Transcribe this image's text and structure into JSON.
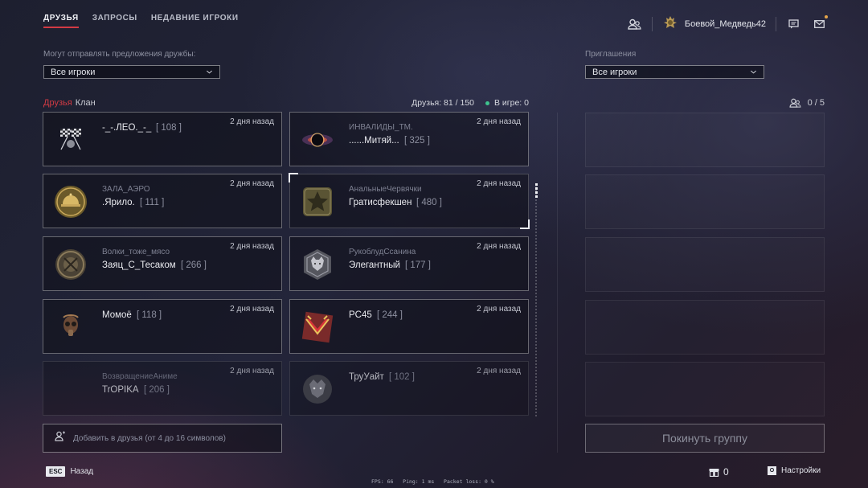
{
  "tabs": [
    {
      "label": "ДРУЗЬЯ",
      "active": true
    },
    {
      "label": "ЗАПРОСЫ",
      "active": false
    },
    {
      "label": "НЕДАВНИЕ ИГРОКИ",
      "active": false
    }
  ],
  "user": {
    "name": "Боевой_Медведь42"
  },
  "friend_filter": {
    "label": "Могут отправлять предложения дружбы:",
    "value": "Все игроки"
  },
  "invite_filter": {
    "label": "Приглашения",
    "value": "Все игроки"
  },
  "subtabs": {
    "friends": "Друзья",
    "clan": "Клан"
  },
  "stats": {
    "friends": "Друзья: 81 / 150",
    "in_game": "В игре: 0"
  },
  "invites_count": "0 / 5",
  "friends": [
    {
      "clan": "",
      "nick": "-_-.ЛЕО._-_",
      "level": "[ 108 ]",
      "time": "2 дня назад",
      "emblem": "racing-flags-emblem-icon"
    },
    {
      "clan": "ИНВАЛИДЫ_ТМ.",
      "nick": "......Митяй...",
      "level": "[ 325 ]",
      "time": "2 дня назад",
      "emblem": "black-hole-emblem-icon"
    },
    {
      "clan": "ЗАЛА_АЭРО",
      "nick": ".Ярило.",
      "level": "[ 111 ]",
      "time": "2 дня назад",
      "emblem": "bronze-dome-emblem-icon"
    },
    {
      "clan": "АнальныеЧервячки",
      "nick": "Гратисфекшен",
      "level": "[ 480 ]",
      "time": "2 дня назад",
      "emblem": "star-emblem-icon"
    },
    {
      "clan": "Волки_тоже_мясо",
      "nick": "Заяц_С_Тесаком",
      "level": "[ 266 ]",
      "time": "2 дня назад",
      "emblem": "round-shield-emblem-icon"
    },
    {
      "clan": "РукоблудСсанина",
      "nick": "Элегантный",
      "level": "[ 177 ]",
      "time": "2 дня назад",
      "emblem": "wolf-emblem-icon"
    },
    {
      "clan": "",
      "nick": "Момоё",
      "level": "[ 118 ]",
      "time": "2 дня назад",
      "emblem": "gas-mask-emblem-icon"
    },
    {
      "clan": "",
      "nick": "PC45",
      "level": "[ 244 ]",
      "time": "2 дня назад",
      "emblem": "red-chevron-emblem-icon"
    },
    {
      "clan": "ВозвращениеАниме",
      "nick": "TrOPIKA",
      "level": "[ 206 ]",
      "time": "2 дня назад",
      "emblem": "none"
    },
    {
      "clan": "",
      "nick": "ТруУайт",
      "level": "[ 102 ]",
      "time": "2 дня назад",
      "emblem": "beast-emblem-icon"
    }
  ],
  "add_friend": {
    "placeholder": "Добавить в друзья (от 4 до 16 символов)"
  },
  "leave_group": "Покинуть группу",
  "bottom": {
    "esc_key": "ESC",
    "back": "Назад",
    "fps": "FPS: 66",
    "ping": "Ping: 1 ms",
    "packet_loss": "Packet loss: 0 %",
    "currency": "0",
    "settings_key": "O",
    "settings": "Настройки"
  },
  "colors": {
    "accent": "#d23a44",
    "online": "#3ec48e"
  }
}
